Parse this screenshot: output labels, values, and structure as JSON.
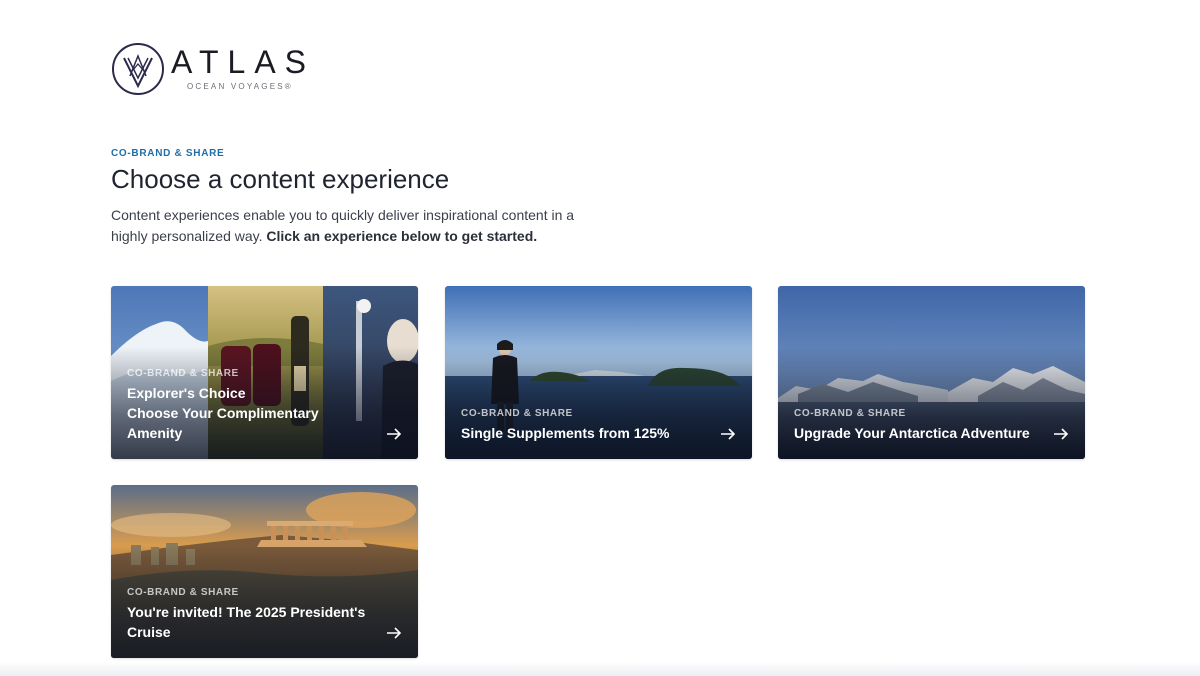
{
  "brand": {
    "wordmark": "ATLAS",
    "tagline": "OCEAN VOYAGES®",
    "colors": {
      "primary": "#2b2a4c",
      "eyebrow": "#1f6fa6"
    }
  },
  "header": {
    "eyebrow": "CO-BRAND & SHARE",
    "title": "Choose a content experience",
    "intro_text": "Content experiences enable you to quickly deliver inspirational content in a highly personalized way.",
    "intro_cta": "Click an experience below to get started."
  },
  "cards": [
    {
      "eyebrow": "CO-BRAND & SHARE",
      "title_lines": [
        "Explorer's Choice",
        "Choose Your Complimentary",
        "Amenity"
      ],
      "arrow_icon": "arrow-right-icon"
    },
    {
      "eyebrow": "CO-BRAND & SHARE",
      "title": "Single Supplements from 125%",
      "arrow_icon": "arrow-right-icon"
    },
    {
      "eyebrow": "CO-BRAND & SHARE",
      "title": "Upgrade Your Antarctica Adventure",
      "arrow_icon": "arrow-right-icon"
    },
    {
      "eyebrow": "CO-BRAND & SHARE",
      "title_lines": [
        "You're invited! The 2025 President's",
        "Cruise"
      ],
      "arrow_icon": "arrow-right-icon"
    }
  ]
}
